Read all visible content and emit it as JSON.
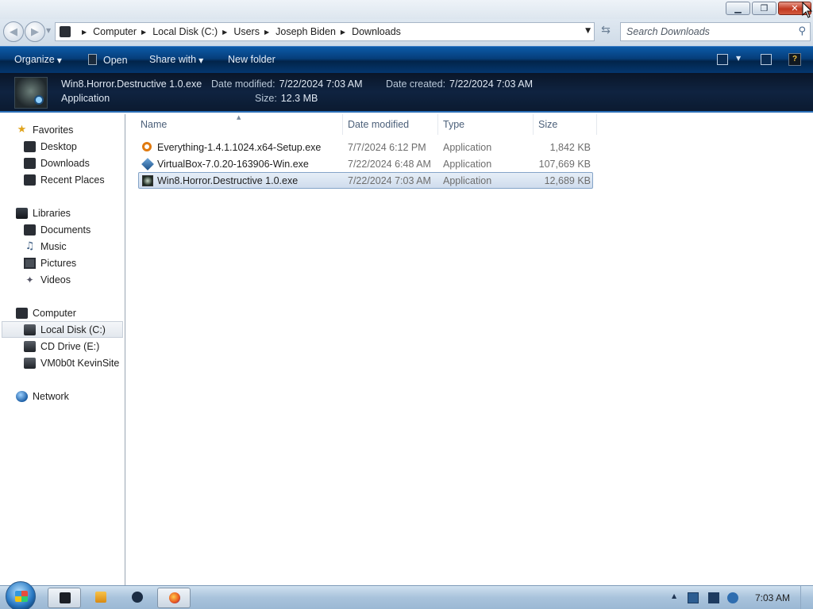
{
  "address": {
    "crumbs": [
      "Computer",
      "Local Disk (C:)",
      "Users",
      "Joseph Biden",
      "Downloads"
    ],
    "search_placeholder": "Search Downloads"
  },
  "toolbar": {
    "organize": "Organize",
    "open": "Open",
    "share_with": "Share with",
    "new_folder": "New folder"
  },
  "details": {
    "name": "Win8.Horror.Destructive 1.0.exe",
    "type": "Application",
    "date_modified_label": "Date modified:",
    "date_modified": "7/22/2024 7:03 AM",
    "date_created_label": "Date created:",
    "date_created": "7/22/2024 7:03 AM",
    "size_label": "Size:",
    "size": "12.3 MB"
  },
  "nav": {
    "favorites": "Favorites",
    "desktop": "Desktop",
    "downloads": "Downloads",
    "recent_places": "Recent Places",
    "libraries": "Libraries",
    "documents": "Documents",
    "music": "Music",
    "pictures": "Pictures",
    "videos": "Videos",
    "computer": "Computer",
    "local_disk": "Local Disk (C:)",
    "cd_drive": "CD Drive (E:)",
    "vm_site": "VM0b0t KevinSite",
    "network": "Network"
  },
  "columns": {
    "name": "Name",
    "date_modified": "Date modified",
    "type": "Type",
    "size": "Size"
  },
  "files": [
    {
      "name": "Everything-1.4.1.1024.x64-Setup.exe",
      "date": "7/7/2024 6:12 PM",
      "type": "Application",
      "size": "1,842 KB",
      "icon": "everything-icon"
    },
    {
      "name": "VirtualBox-7.0.20-163906-Win.exe",
      "date": "7/22/2024 6:48 AM",
      "type": "Application",
      "size": "107,669 KB",
      "icon": "virtualbox-icon"
    },
    {
      "name": "Win8.Horror.Destructive 1.0.exe",
      "date": "7/22/2024 7:03 AM",
      "type": "Application",
      "size": "12,689 KB",
      "icon": "win8-horror-icon",
      "selected": true
    }
  ],
  "taskbar": {
    "clock": "7:03 AM"
  }
}
